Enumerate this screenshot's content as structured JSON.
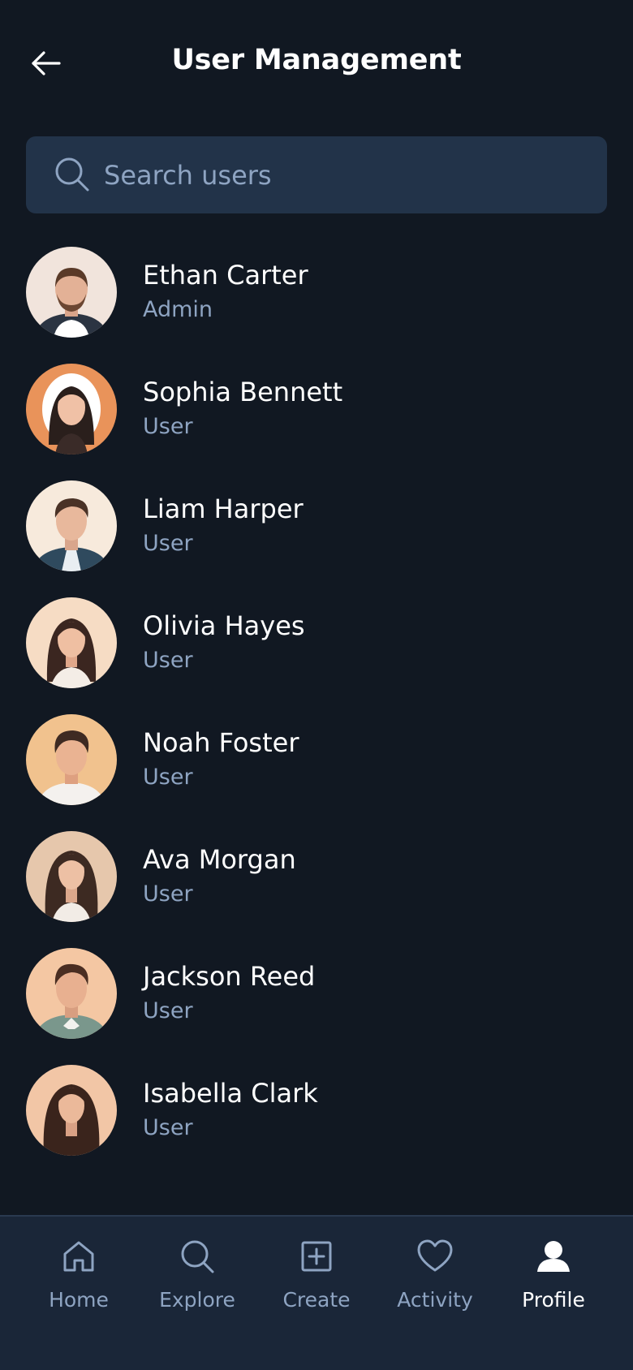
{
  "header": {
    "title": "User Management",
    "back_icon": "arrow-left-icon"
  },
  "search": {
    "placeholder": "Search users",
    "value": "",
    "icon": "search-icon"
  },
  "users": [
    {
      "name": "Ethan Carter",
      "role": "Admin"
    },
    {
      "name": "Sophia Bennett",
      "role": "User"
    },
    {
      "name": "Liam Harper",
      "role": "User"
    },
    {
      "name": "Olivia Hayes",
      "role": "User"
    },
    {
      "name": "Noah Foster",
      "role": "User"
    },
    {
      "name": "Ava Morgan",
      "role": "User"
    },
    {
      "name": "Jackson Reed",
      "role": "User"
    },
    {
      "name": "Isabella Clark",
      "role": "User"
    }
  ],
  "bottom_nav": {
    "items": [
      {
        "label": "Home",
        "icon": "home-icon",
        "active": false
      },
      {
        "label": "Explore",
        "icon": "search-icon",
        "active": false
      },
      {
        "label": "Create",
        "icon": "plus-square-icon",
        "active": false
      },
      {
        "label": "Activity",
        "icon": "heart-icon",
        "active": false
      },
      {
        "label": "Profile",
        "icon": "person-icon",
        "active": true
      }
    ]
  },
  "colors": {
    "background": "#111822",
    "search_bg": "#223349",
    "nav_bg": "#1a2638",
    "muted_text": "#8ea4c2",
    "primary_text": "#ffffff"
  }
}
